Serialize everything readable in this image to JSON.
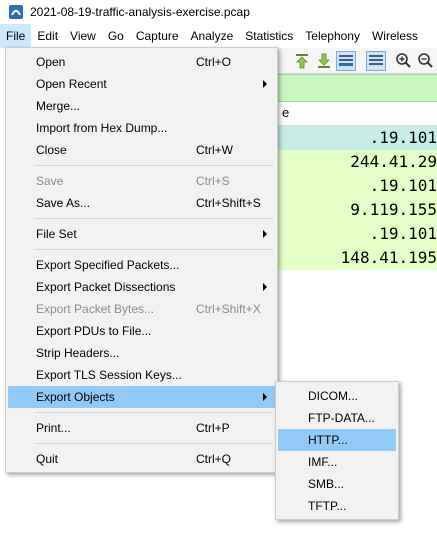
{
  "window": {
    "title": "2021-08-19-traffic-analysis-exercise.pcap"
  },
  "menubar": {
    "items": [
      "File",
      "Edit",
      "View",
      "Go",
      "Capture",
      "Analyze",
      "Statistics",
      "Telephony",
      "Wireless"
    ]
  },
  "packet_list": {
    "header_partial": "e",
    "rows": [
      {
        "text": ".19.101",
        "color": "#c6ede6"
      },
      {
        "text": "244.41.29",
        "color": "#e4ffc7"
      },
      {
        "text": ".19.101",
        "color": "#e4ffc7"
      },
      {
        "text": "9.119.155",
        "color": "#e4ffc7"
      },
      {
        "text": ".19.101",
        "color": "#e4ffc7"
      },
      {
        "text": "148.41.195",
        "color": "#e4ffc7"
      }
    ]
  },
  "file_menu": {
    "items": [
      {
        "label": "Open",
        "shortcut": "Ctrl+O"
      },
      {
        "label": "Open Recent",
        "shortcut": ""
      },
      {
        "label": "Merge...",
        "shortcut": ""
      },
      {
        "label": "Import from Hex Dump...",
        "shortcut": ""
      },
      {
        "label": "Close",
        "shortcut": "Ctrl+W"
      },
      {
        "label": "Save",
        "shortcut": "Ctrl+S"
      },
      {
        "label": "Save As...",
        "shortcut": "Ctrl+Shift+S"
      },
      {
        "label": "File Set",
        "shortcut": ""
      },
      {
        "label": "Export Specified Packets...",
        "shortcut": ""
      },
      {
        "label": "Export Packet Dissections",
        "shortcut": ""
      },
      {
        "label": "Export Packet Bytes...",
        "shortcut": "Ctrl+Shift+X"
      },
      {
        "label": "Export PDUs to File...",
        "shortcut": ""
      },
      {
        "label": "Strip Headers...",
        "shortcut": ""
      },
      {
        "label": "Export TLS Session Keys...",
        "shortcut": ""
      },
      {
        "label": "Export Objects",
        "shortcut": ""
      },
      {
        "label": "Print...",
        "shortcut": "Ctrl+P"
      },
      {
        "label": "Quit",
        "shortcut": "Ctrl+Q"
      }
    ]
  },
  "export_objects_submenu": {
    "items": [
      "DICOM...",
      "FTP-DATA...",
      "HTTP...",
      "IMF...",
      "SMB...",
      "TFTP..."
    ]
  },
  "colors": {
    "menu_bg": "#f2f2f2",
    "highlight": "#91c9f7",
    "filter_bar": "#c8f7c0",
    "selected_row": "#c6ede6",
    "row_green": "#e4ffc7",
    "disabled_text": "#8a8a8a"
  }
}
